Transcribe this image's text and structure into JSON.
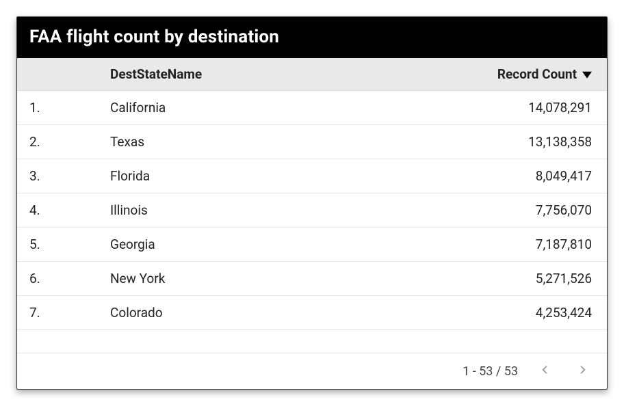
{
  "title": "FAA flight count by destination",
  "columns": {
    "name": "DestStateName",
    "count": "Record Count"
  },
  "sort": {
    "column": "count",
    "direction": "desc"
  },
  "rows": [
    {
      "rank": "1.",
      "name": "California",
      "count": "14,078,291"
    },
    {
      "rank": "2.",
      "name": "Texas",
      "count": "13,138,358"
    },
    {
      "rank": "3.",
      "name": "Florida",
      "count": "8,049,417"
    },
    {
      "rank": "4.",
      "name": "Illinois",
      "count": "7,756,070"
    },
    {
      "rank": "5.",
      "name": "Georgia",
      "count": "7,187,810"
    },
    {
      "rank": "6.",
      "name": "New York",
      "count": "5,271,526"
    },
    {
      "rank": "7.",
      "name": "Colorado",
      "count": "4,253,424"
    }
  ],
  "pagination": {
    "label": "1 - 53 / 53"
  },
  "chart_data": {
    "type": "table",
    "title": "FAA flight count by destination",
    "columns": [
      "DestStateName",
      "Record Count"
    ],
    "sort": {
      "column": "Record Count",
      "direction": "desc"
    },
    "total_rows": 53,
    "visible_rows": [
      {
        "DestStateName": "California",
        "Record Count": 14078291
      },
      {
        "DestStateName": "Texas",
        "Record Count": 13138358
      },
      {
        "DestStateName": "Florida",
        "Record Count": 8049417
      },
      {
        "DestStateName": "Illinois",
        "Record Count": 7756070
      },
      {
        "DestStateName": "Georgia",
        "Record Count": 7187810
      },
      {
        "DestStateName": "New York",
        "Record Count": 5271526
      },
      {
        "DestStateName": "Colorado",
        "Record Count": 4253424
      }
    ]
  }
}
